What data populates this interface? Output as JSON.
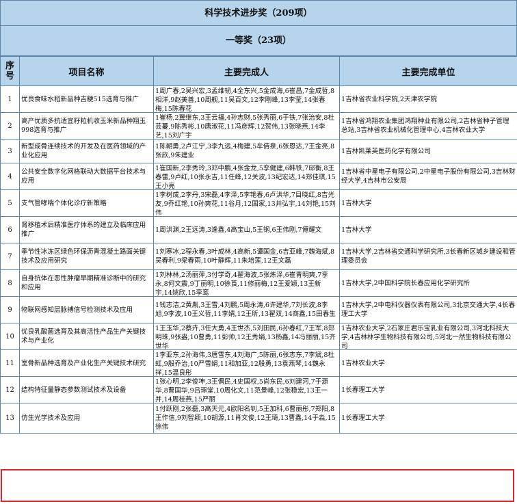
{
  "title": "科学技术进步奖（209项）",
  "subtitle": "一等奖（23项）",
  "headers": {
    "seq": "序号",
    "project": "项目名称",
    "people": "主要完成人",
    "units": "主要完成单位"
  },
  "rows": [
    {
      "no": "1",
      "project": "优良食味水稻新品种吉粳515选育与推广",
      "people": "1周广春,2吴兴宏,3孟维韧,4全东兴,5金成海,6崔昌,7金成哲,8相洋,9赵美善,10周舰,11吴百文,12李剛峰,13李莹,14张春梅,15陈春花",
      "units": "1吉林省农业科学院,2天津农学院"
    },
    {
      "no": "2",
      "project": "高产优质多抗适宜籽粒机收玉米新品种翔玉998选育与推广",
      "people": "1崔杨,2冀继东,3王云福,4孙志财,5张秀丽,6于铁,7张治安,8杜芸蔓,9陈秀彬,10唐淑花,11冯彦辉,12贺伟,13张晓燕,14李艺,15刘广宇",
      "units": "1吉林省鸿翔农业集团鸿翔种业有限公司,2吉林省种子管理总站,3吉林省农业机械化管理中心,4吉林农业大学"
    },
    {
      "no": "3",
      "project": "新型成骨连续技术的开发及在医药领域的产业化应用",
      "people": "1陈朝勇,2卢江宁,3李九远,4梅建,5牟倩泉,6张恩达,7王金亮,8张欣,9朱建业",
      "units": "1吉林凯莱英医药化学有限公司"
    },
    {
      "no": "4",
      "project": "公共安全数字化网格联动大数据平台技术与应用",
      "people": "1崔国新,2李秀玲,3邓中鹏,4张金龙,5孪健建,6韩铁,7邱衡,8王春雷,9卢红,10张永吉,11任峰,12关波,13纪宏达,14郑佳琪,15王小亮",
      "units": "1吉林省中星电子有限公司,2中星电子股份有限公司,3吉林财经大学,4吉林市公安局"
    },
    {
      "no": "5",
      "project": "支气管哮喘个体化诊疗新策略",
      "people": "1李树成,2李丹,3宋磊,4李泽,5李艳春,6卢洪华,7目晓红,8吉光友,9乔红艳,10孙爽花,11谷月,12国家,13井弘宇,14刘艳,15刘伟",
      "units": "1吉林大学"
    },
    {
      "no": "6",
      "project": "肾移植术后精准医疗体系的建立及临床应用推广",
      "people": "1周洪渊,2王远涛,3逄鑫,4高宝山,5王钢,6王伟刚,7傅耀文",
      "units": "1吉林大学"
    },
    {
      "no": "7",
      "project": "季节性冰冻区绿色环保沥青混凝土路面关键技术及应用研究",
      "people": "1刘寒冰,2程永春,3叶成林,4高新,5谭国金,6吉亚峰,7魏海斌,8吴春利,9梁春雨,10叶静辉,11朱培莲,12王文磊",
      "units": "1吉林大学,2吉林省交通科学研究所,3长春新区城乡建设和管理委员会"
    },
    {
      "no": "8",
      "project": "自身抗体在恶性肿瘤早期精准诊断中的研究和应用",
      "people": "1刘林林,2汤丽萍,3付学奇,4翟海波,5张炼泽,6崔青明爽,7孪永,8何文震,9丁丽明,10徐莨,11修丽梅,12王爱颖,13王新宇,14姚欣,15孪鸾",
      "units": "1吉林大学,2中国科学院长春应用化学研究所"
    },
    {
      "no": "9",
      "project": "物联网感知层脉搏信号检测技术及应用",
      "people": "1钱志洁,2黄胤,3王雪,4刘鹏,5周永涛,6许建华,7刘长波,8李旭,9李波,10王义哲,11李婧,12王昕,13翟双,14商鑫,15田春生",
      "units": "1吉林大学,2中电科仪器仪表有限公司,3北京交通大学,4长春理工大学"
    },
    {
      "no": "10",
      "project": "优良乳酸菌选育及其高活性产品生产关键技术与产业化",
      "people": "1王玉华,2蔡卉,3任大勇,4王世杰,5刘田民,6孙春红,7王军,8郑明珠,9张盎,10曹勇,11彭帅,12王秀娟,13杨鑫,14冯丽丽,15齐世华",
      "units": "1吉林农业大学,2石家庄君乐宝乳业有限公司,3河北科技大学,4吉林林学生物科技有限公司,5河北一然生物科技有限公司"
    },
    {
      "no": "11",
      "project": "室骨新品种选育及产业化生产关键技术研究",
      "people": "1李亚东,2孙海伟,3唐雪东,4刘海广,5陈丽,6张志东,7李斌,8杜虹,9殷乔治,10严雪娟,11和加亚,12殷勇,13袁燕琴,14魏永祥,15温良彤",
      "units": "1吉林农业大学"
    },
    {
      "no": "12",
      "project": "结构特征量静态参数测试技术及设备",
      "people": "1张心明,2李俊坤,3王偶民,4史国权,5尚东民,6刘建河,7于源华,8曹国华,9吕琢堂,10周化文,11范景峰,12张稳宏,13王一并,14周桂燕,15严丽",
      "units": "1长春理工大学"
    },
    {
      "no": "13",
      "project": "仿生光学技术及应用",
      "people": "1付跃刚,2张磊,3高天元,4欧阳名钊,5王加科,6曹丽彤,7郑阳,8王作信,9刘智颖,10胡源,11肖文俊,12王琦,13曹鑫,14于淼,15徐伟",
      "units": "1长春理工大学"
    }
  ]
}
